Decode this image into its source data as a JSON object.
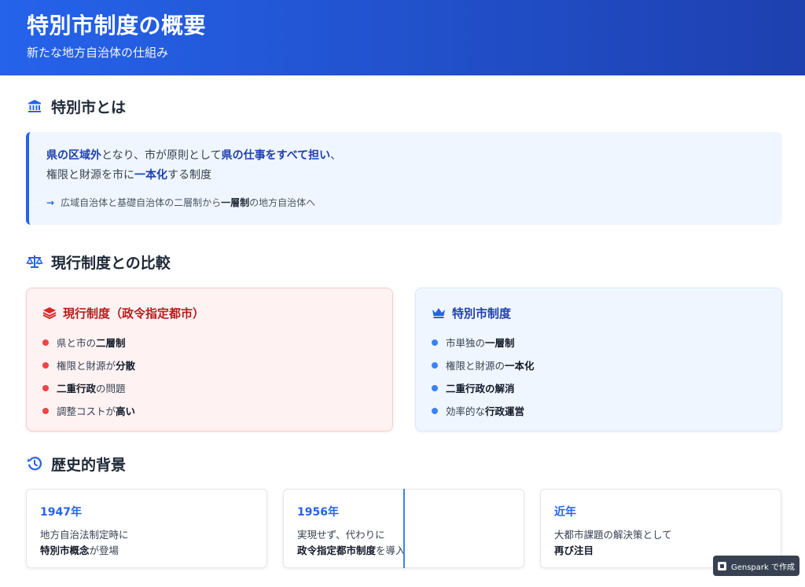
{
  "header": {
    "title": "特別市制度の概要",
    "subtitle": "新たな地方自治体の仕組み"
  },
  "section_about": {
    "title": "特別市とは",
    "icon": "landmark-icon",
    "line1": [
      {
        "text": "県の区域外",
        "bold": true
      },
      {
        "text": "となり、市が原則として",
        "bold": false
      },
      {
        "text": "県の仕事をすべて担い",
        "bold": true
      },
      {
        "text": "、",
        "bold": false
      }
    ],
    "line2": [
      {
        "text": "権限と財源を市に",
        "bold": false
      },
      {
        "text": "一本化",
        "bold": true
      },
      {
        "text": "する制度",
        "bold": false
      }
    ],
    "note_arrow": "→",
    "note": [
      {
        "text": "広域自治体と基礎自治体の二層制から",
        "bold": false
      },
      {
        "text": "一層制",
        "bold": true
      },
      {
        "text": "の地方自治体へ",
        "bold": false
      }
    ]
  },
  "section_compare": {
    "title": "現行制度との比較",
    "icon": "scale-icon",
    "current": {
      "title": "現行制度（政令指定都市）",
      "icon": "layers-icon",
      "items": [
        [
          {
            "text": "県と市の",
            "bold": false
          },
          {
            "text": "二層制",
            "bold": true
          }
        ],
        [
          {
            "text": "権限と財源が",
            "bold": false
          },
          {
            "text": "分散",
            "bold": true
          }
        ],
        [
          {
            "text": "二重行政",
            "bold": true
          },
          {
            "text": "の問題",
            "bold": false
          }
        ],
        [
          {
            "text": "調整コストが",
            "bold": false
          },
          {
            "text": "高い",
            "bold": true
          }
        ]
      ]
    },
    "new": {
      "title": "特別市制度",
      "icon": "crown-icon",
      "items": [
        [
          {
            "text": "市単独の",
            "bold": false
          },
          {
            "text": "一層制",
            "bold": true
          }
        ],
        [
          {
            "text": "権限と財源の",
            "bold": false
          },
          {
            "text": "一本化",
            "bold": true
          }
        ],
        [
          {
            "text": "二重行政の解消",
            "bold": true
          }
        ],
        [
          {
            "text": "効率的な",
            "bold": false
          },
          {
            "text": "行政運営",
            "bold": true
          }
        ]
      ]
    }
  },
  "section_history": {
    "title": "歴史的背景",
    "icon": "history-icon",
    "cards": [
      {
        "year": "1947年",
        "line1": [
          {
            "text": "地方自治法制定時に",
            "bold": false
          }
        ],
        "line2": [
          {
            "text": "特別市概念",
            "bold": true
          },
          {
            "text": "が登場",
            "bold": false
          }
        ]
      },
      {
        "year": "1956年",
        "line1": [
          {
            "text": "実現せず、代わりに",
            "bold": false
          }
        ],
        "line2": [
          {
            "text": "政令指定都市制度",
            "bold": true
          },
          {
            "text": "を導入",
            "bold": false
          }
        ]
      },
      {
        "year": "近年",
        "line1": [
          {
            "text": "大都市課題の解決策として",
            "bold": false
          }
        ],
        "line2": [
          {
            "text": "再び注目",
            "bold": true
          }
        ]
      }
    ]
  },
  "badge": {
    "label": "Genspark で作成"
  },
  "colors": {
    "primary": "#2563eb",
    "primary_dark": "#1e40af",
    "current_accent": "#b91c1c",
    "current_dot": "#ef4444",
    "new_dot": "#3b82f6"
  }
}
